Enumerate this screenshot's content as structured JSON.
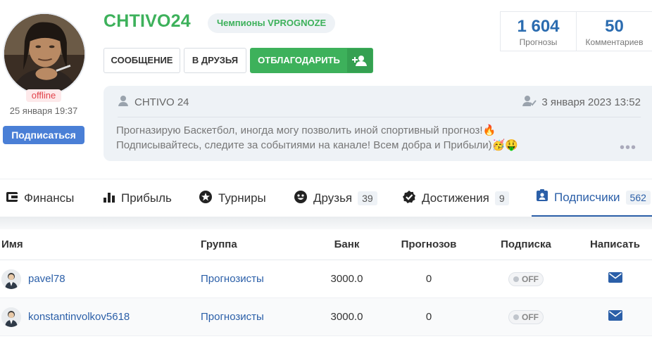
{
  "profile": {
    "username": "CHTIVO24",
    "group_badge": "Чемпионы VPROGNOZE",
    "status": "offline",
    "last_seen": "25 января 19:37",
    "subscribe_label": "Подписаться"
  },
  "actions": {
    "message_label": "СООБЩЕНИЕ",
    "friend_label": "В ДРУЗЬЯ",
    "thank_label": "ОТБЛАГОДАРИТЬ"
  },
  "stats": [
    {
      "value": "1 604",
      "label": "Прогнозы"
    },
    {
      "value": "50",
      "label": "Комментариев"
    }
  ],
  "bio": {
    "author": "CHTIVO 24",
    "date": "3 января 2023 13:52",
    "line1": "Прогназирую Баскетбол, иногда могу позволить иной спортивный прогноз!🔥",
    "line2": "Подписывайтесь, следите за событиями на канале! Всем добра и Прибыли)🥳🤑",
    "more": "•••"
  },
  "tabs": [
    {
      "label": "Финансы",
      "icon": "wallet-icon"
    },
    {
      "label": "Прибыль",
      "icon": "bar-chart-icon"
    },
    {
      "label": "Турниры",
      "icon": "star-icon"
    },
    {
      "label": "Друзья",
      "icon": "smile-icon",
      "count": "39"
    },
    {
      "label": "Достижения",
      "icon": "badge-check-icon",
      "count": "9"
    },
    {
      "label": "Подписчики",
      "icon": "id-card-icon",
      "count": "562",
      "active": true
    }
  ],
  "table": {
    "headers": {
      "name": "Имя",
      "group": "Группа",
      "bank": "Банк",
      "predictions": "Прогнозов",
      "subscription": "Подписка",
      "write": "Написать"
    },
    "rows": [
      {
        "name": "pavel78",
        "group": "Прогнозисты",
        "bank": "3000.0",
        "predictions": "0",
        "subscription": "OFF"
      },
      {
        "name": "konstantinvolkov5618",
        "group": "Прогнозисты",
        "bank": "3000.0",
        "predictions": "0",
        "subscription": "OFF"
      }
    ]
  },
  "colors": {
    "accent_green": "#3db15b",
    "accent_blue": "#2b5fa8",
    "subscribe_blue": "#4a7fd6",
    "offline_red": "#e2434b"
  }
}
